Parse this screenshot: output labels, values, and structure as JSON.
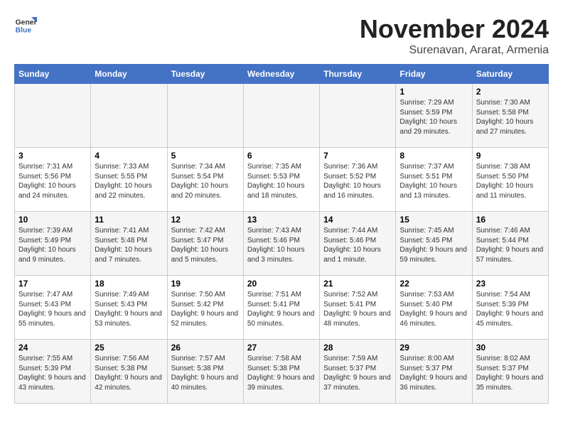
{
  "logo": {
    "general": "General",
    "blue": "Blue"
  },
  "header": {
    "month": "November 2024",
    "location": "Surenavan, Ararat, Armenia"
  },
  "weekdays": [
    "Sunday",
    "Monday",
    "Tuesday",
    "Wednesday",
    "Thursday",
    "Friday",
    "Saturday"
  ],
  "weeks": [
    [
      {
        "day": "",
        "info": ""
      },
      {
        "day": "",
        "info": ""
      },
      {
        "day": "",
        "info": ""
      },
      {
        "day": "",
        "info": ""
      },
      {
        "day": "",
        "info": ""
      },
      {
        "day": "1",
        "info": "Sunrise: 7:29 AM\nSunset: 5:59 PM\nDaylight: 10 hours and 29 minutes."
      },
      {
        "day": "2",
        "info": "Sunrise: 7:30 AM\nSunset: 5:58 PM\nDaylight: 10 hours and 27 minutes."
      }
    ],
    [
      {
        "day": "3",
        "info": "Sunrise: 7:31 AM\nSunset: 5:56 PM\nDaylight: 10 hours and 24 minutes."
      },
      {
        "day": "4",
        "info": "Sunrise: 7:33 AM\nSunset: 5:55 PM\nDaylight: 10 hours and 22 minutes."
      },
      {
        "day": "5",
        "info": "Sunrise: 7:34 AM\nSunset: 5:54 PM\nDaylight: 10 hours and 20 minutes."
      },
      {
        "day": "6",
        "info": "Sunrise: 7:35 AM\nSunset: 5:53 PM\nDaylight: 10 hours and 18 minutes."
      },
      {
        "day": "7",
        "info": "Sunrise: 7:36 AM\nSunset: 5:52 PM\nDaylight: 10 hours and 16 minutes."
      },
      {
        "day": "8",
        "info": "Sunrise: 7:37 AM\nSunset: 5:51 PM\nDaylight: 10 hours and 13 minutes."
      },
      {
        "day": "9",
        "info": "Sunrise: 7:38 AM\nSunset: 5:50 PM\nDaylight: 10 hours and 11 minutes."
      }
    ],
    [
      {
        "day": "10",
        "info": "Sunrise: 7:39 AM\nSunset: 5:49 PM\nDaylight: 10 hours and 9 minutes."
      },
      {
        "day": "11",
        "info": "Sunrise: 7:41 AM\nSunset: 5:48 PM\nDaylight: 10 hours and 7 minutes."
      },
      {
        "day": "12",
        "info": "Sunrise: 7:42 AM\nSunset: 5:47 PM\nDaylight: 10 hours and 5 minutes."
      },
      {
        "day": "13",
        "info": "Sunrise: 7:43 AM\nSunset: 5:46 PM\nDaylight: 10 hours and 3 minutes."
      },
      {
        "day": "14",
        "info": "Sunrise: 7:44 AM\nSunset: 5:46 PM\nDaylight: 10 hours and 1 minute."
      },
      {
        "day": "15",
        "info": "Sunrise: 7:45 AM\nSunset: 5:45 PM\nDaylight: 9 hours and 59 minutes."
      },
      {
        "day": "16",
        "info": "Sunrise: 7:46 AM\nSunset: 5:44 PM\nDaylight: 9 hours and 57 minutes."
      }
    ],
    [
      {
        "day": "17",
        "info": "Sunrise: 7:47 AM\nSunset: 5:43 PM\nDaylight: 9 hours and 55 minutes."
      },
      {
        "day": "18",
        "info": "Sunrise: 7:49 AM\nSunset: 5:43 PM\nDaylight: 9 hours and 53 minutes."
      },
      {
        "day": "19",
        "info": "Sunrise: 7:50 AM\nSunset: 5:42 PM\nDaylight: 9 hours and 52 minutes."
      },
      {
        "day": "20",
        "info": "Sunrise: 7:51 AM\nSunset: 5:41 PM\nDaylight: 9 hours and 50 minutes."
      },
      {
        "day": "21",
        "info": "Sunrise: 7:52 AM\nSunset: 5:41 PM\nDaylight: 9 hours and 48 minutes."
      },
      {
        "day": "22",
        "info": "Sunrise: 7:53 AM\nSunset: 5:40 PM\nDaylight: 9 hours and 46 minutes."
      },
      {
        "day": "23",
        "info": "Sunrise: 7:54 AM\nSunset: 5:39 PM\nDaylight: 9 hours and 45 minutes."
      }
    ],
    [
      {
        "day": "24",
        "info": "Sunrise: 7:55 AM\nSunset: 5:39 PM\nDaylight: 9 hours and 43 minutes."
      },
      {
        "day": "25",
        "info": "Sunrise: 7:56 AM\nSunset: 5:38 PM\nDaylight: 9 hours and 42 minutes."
      },
      {
        "day": "26",
        "info": "Sunrise: 7:57 AM\nSunset: 5:38 PM\nDaylight: 9 hours and 40 minutes."
      },
      {
        "day": "27",
        "info": "Sunrise: 7:58 AM\nSunset: 5:38 PM\nDaylight: 9 hours and 39 minutes."
      },
      {
        "day": "28",
        "info": "Sunrise: 7:59 AM\nSunset: 5:37 PM\nDaylight: 9 hours and 37 minutes."
      },
      {
        "day": "29",
        "info": "Sunrise: 8:00 AM\nSunset: 5:37 PM\nDaylight: 9 hours and 36 minutes."
      },
      {
        "day": "30",
        "info": "Sunrise: 8:02 AM\nSunset: 5:37 PM\nDaylight: 9 hours and 35 minutes."
      }
    ]
  ]
}
